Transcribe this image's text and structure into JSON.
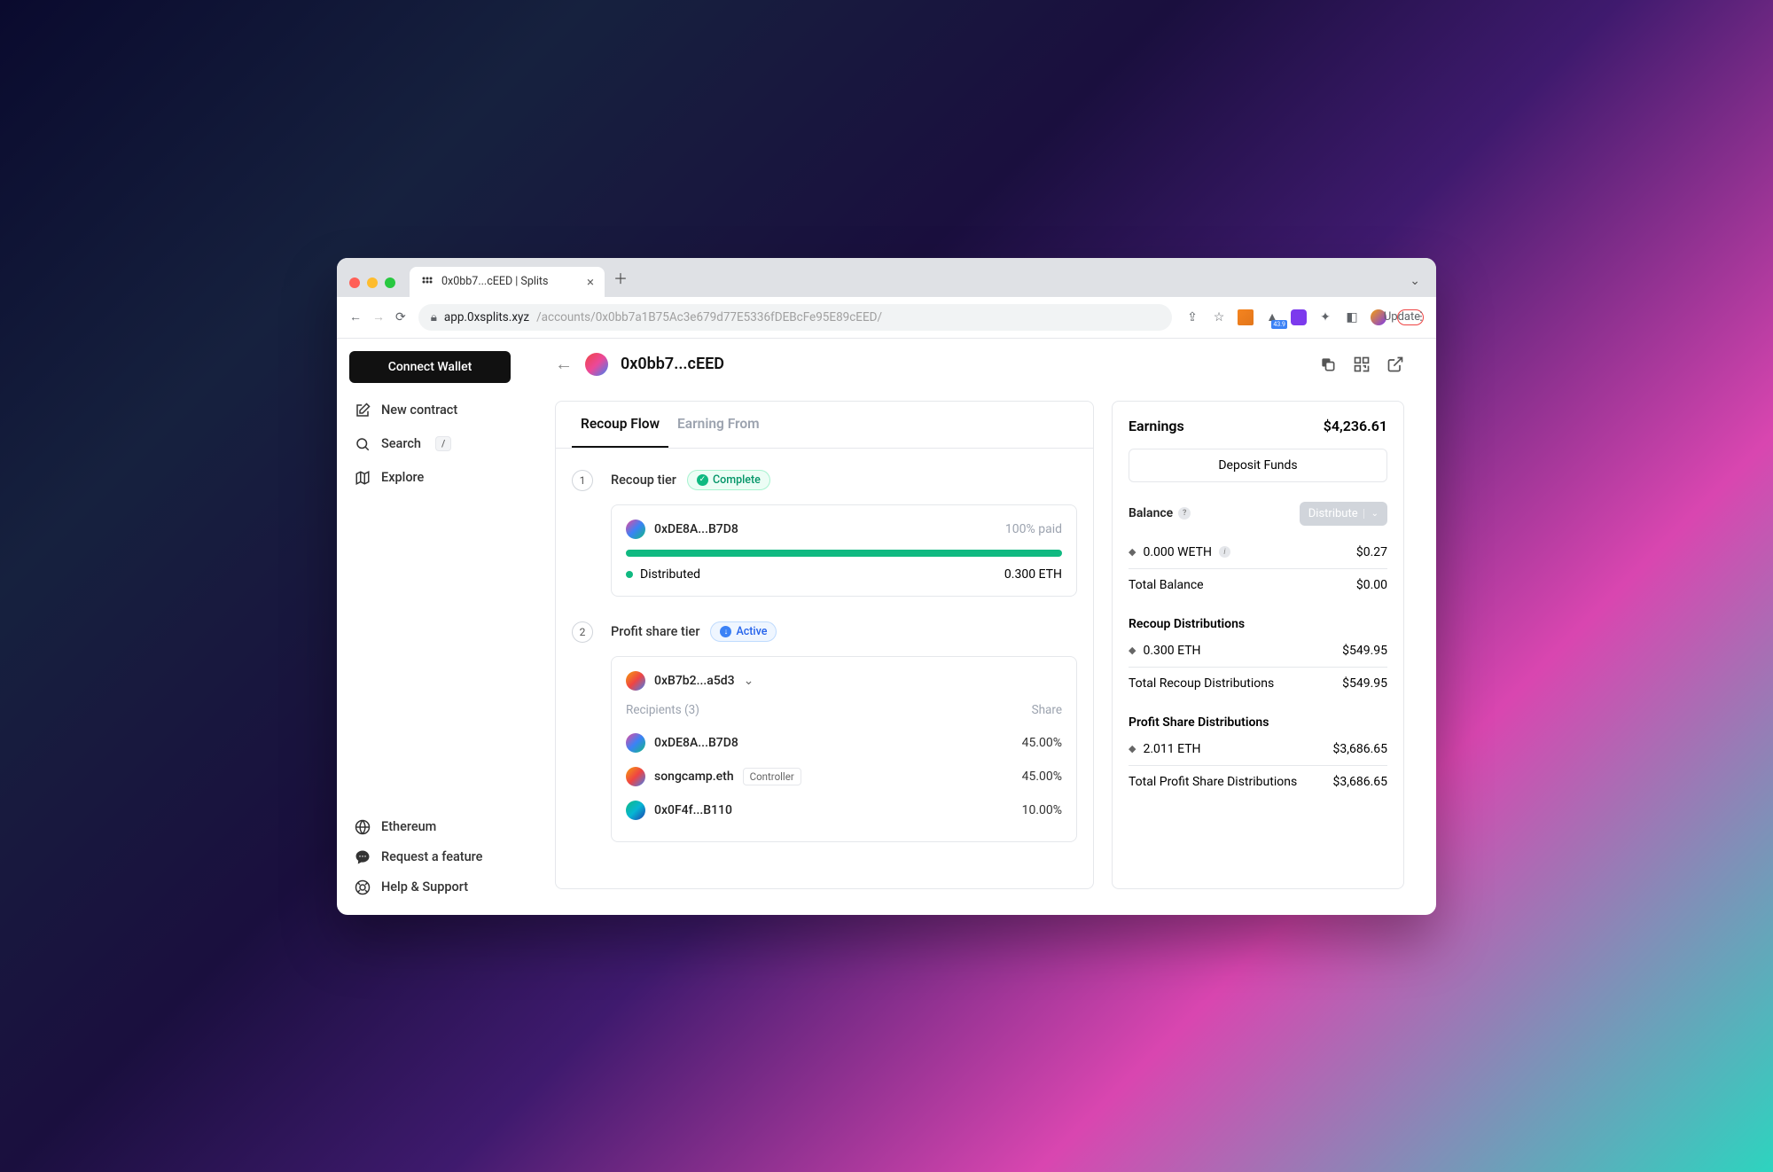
{
  "browser": {
    "tabTitle": "0x0bb7...cEED | Splits",
    "urlHost": "app.0xsplits.xyz",
    "urlPath": "/accounts/0x0bb7a1B75Ac3e679d77E5336fDEBcFe95E89cEED/",
    "updateButton": "Update"
  },
  "sidebar": {
    "connectWallet": "Connect Wallet",
    "newContract": "New contract",
    "search": "Search",
    "searchKey": "/",
    "explore": "Explore",
    "network": "Ethereum",
    "requestFeature": "Request a feature",
    "helpSupport": "Help & Support"
  },
  "page": {
    "address": "0x0bb7...cEED"
  },
  "tabs": {
    "recoupFlow": "Recoup Flow",
    "earningFrom": "Earning From"
  },
  "tier1": {
    "num": "1",
    "title": "Recoup tier",
    "status": "Complete",
    "addr": "0xDE8A...B7D8",
    "paidPct": "100% paid",
    "distributed": "Distributed",
    "amount": "0.300 ETH"
  },
  "tier2": {
    "num": "2",
    "title": "Profit share tier",
    "status": "Active",
    "addr": "0xB7b2...a5d3",
    "recipientsLabel": "Recipients (3)",
    "shareLabel": "Share",
    "r1name": "0xDE8A...B7D8",
    "r1share": "45.00%",
    "r2name": "songcamp.eth",
    "r2badge": "Controller",
    "r2share": "45.00%",
    "r3name": "0x0F4f...B110",
    "r3share": "10.00%"
  },
  "earnings": {
    "title": "Earnings",
    "total": "$4,236.61",
    "deposit": "Deposit Funds",
    "balanceLabel": "Balance",
    "distribute": "Distribute",
    "wethLabel": "0.000 WETH",
    "wethVal": "$0.27",
    "totalBalanceLabel": "Total Balance",
    "totalBalanceVal": "$0.00",
    "recoupTitle": "Recoup Distributions",
    "recoupEth": "0.300 ETH",
    "recoupVal": "$549.95",
    "recoupTotalLabel": "Total Recoup Distributions",
    "recoupTotalVal": "$549.95",
    "psTitle": "Profit Share Distributions",
    "psEth": "2.011 ETH",
    "psVal": "$3,686.65",
    "psTotalLabel": "Total Profit Share Distributions",
    "psTotalVal": "$3,686.65"
  }
}
